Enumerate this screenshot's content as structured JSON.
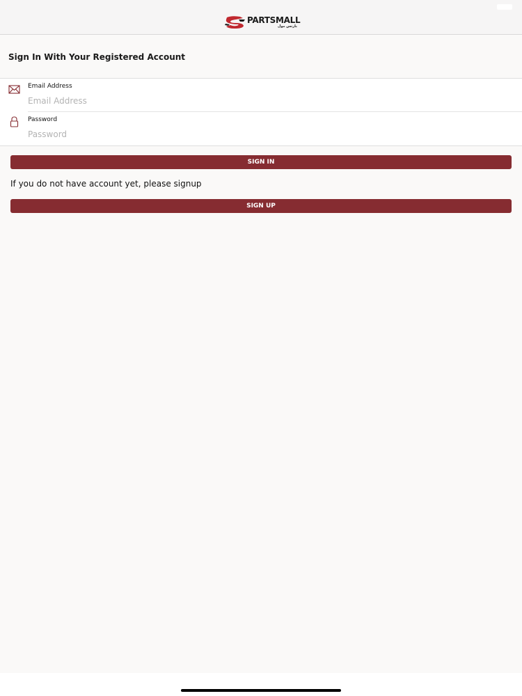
{
  "app": {
    "brand_name": "PARTSMALL",
    "brand_subtitle": "بارتس مول"
  },
  "page": {
    "title": "Sign In With Your Registered Account"
  },
  "form": {
    "email": {
      "label": "Email Address",
      "placeholder": "Email Address",
      "value": "",
      "icon": "envelope-icon"
    },
    "password": {
      "label": "Password",
      "placeholder": "Password",
      "value": "",
      "icon": "lock-icon"
    }
  },
  "actions": {
    "sign_in_label": "SIGN IN",
    "signup_hint": "If you do not have account yet, please signup",
    "sign_up_label": "SIGN UP"
  },
  "colors": {
    "accent": "#862c31",
    "background": "#faf9f8",
    "card": "#ffffff",
    "placeholder": "#b3b3b3"
  }
}
